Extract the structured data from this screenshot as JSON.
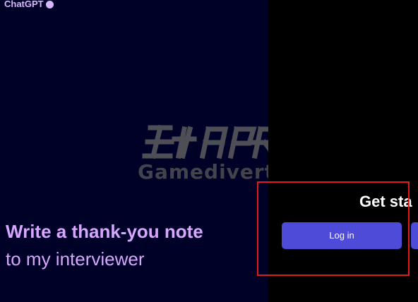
{
  "brand": {
    "name": "ChatGPT",
    "accent": "#d7b7ff"
  },
  "watermark": {
    "text": "Gamedivert"
  },
  "hero": {
    "headline": "Write a thank-you note",
    "subline": "to my interviewer",
    "color": "#d7a6ff"
  },
  "auth": {
    "heading": "Get sta",
    "login_label": "Log in",
    "signup_label": "",
    "button_color": "#4d4bd8"
  },
  "colors": {
    "left_background": "#000126",
    "right_background": "#000000",
    "highlight": "#e01b1b"
  }
}
